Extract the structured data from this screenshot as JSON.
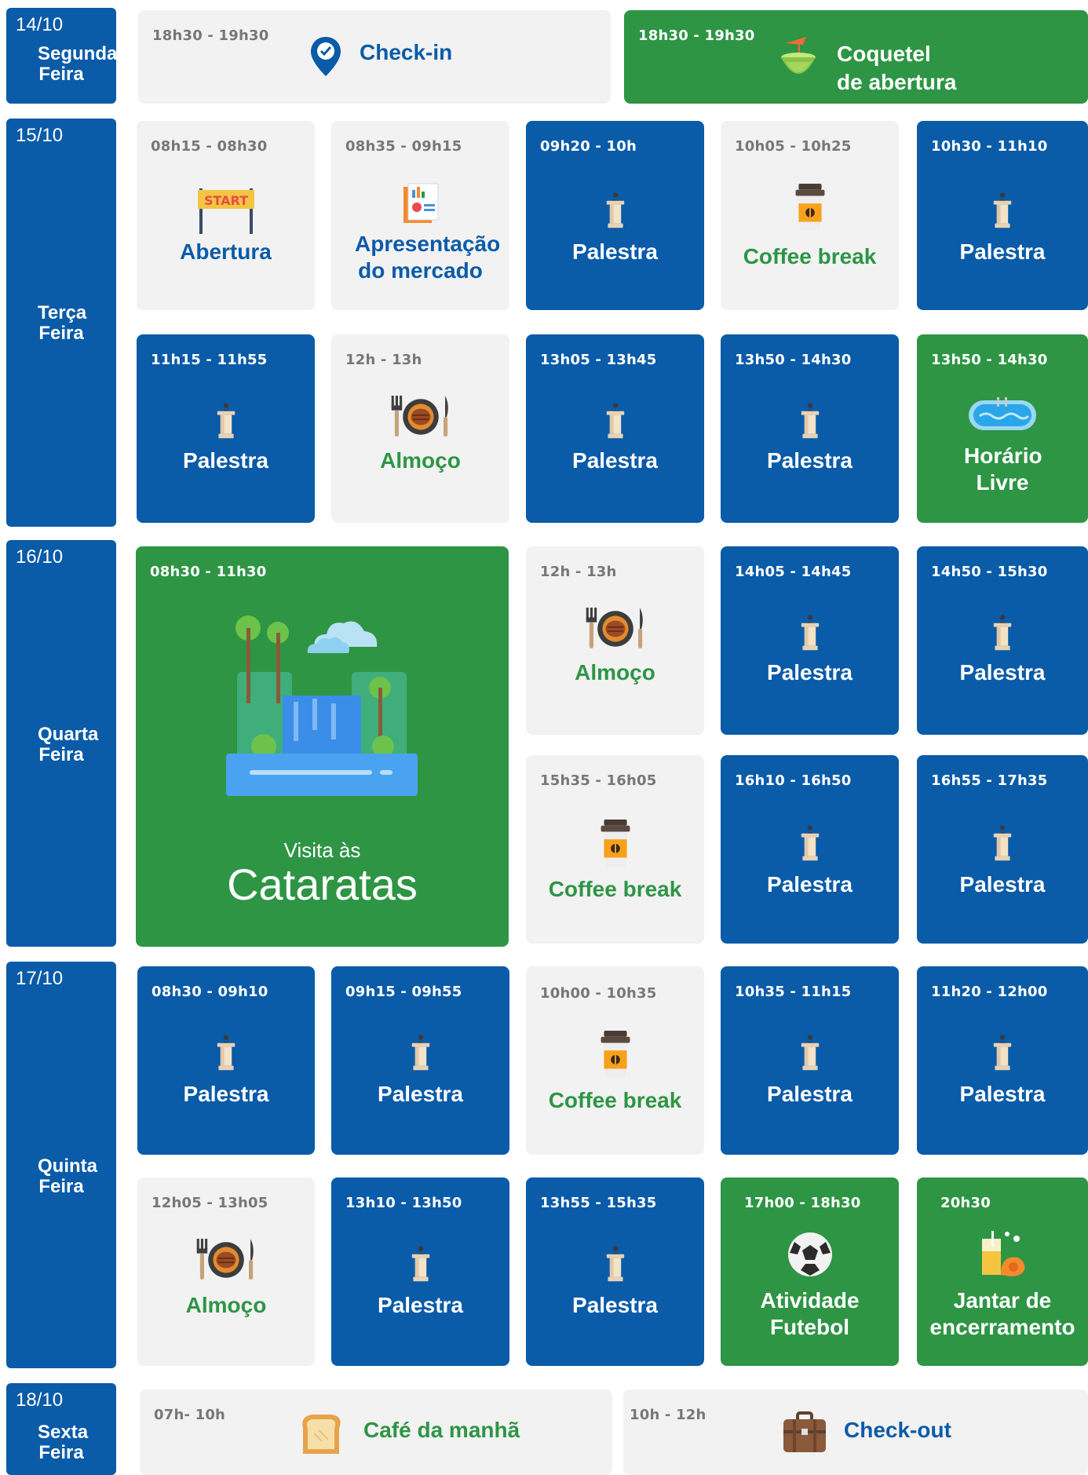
{
  "days": [
    {
      "date": "14/10",
      "name": "Segunda Feira"
    },
    {
      "date": "15/10",
      "name": "Terça Feira"
    },
    {
      "date": "16/10",
      "name": "Quarta Feira"
    },
    {
      "date": "17/10",
      "name": "Quinta Feira"
    },
    {
      "date": "18/10",
      "name": "Sexta Feira"
    }
  ],
  "events": {
    "checkin": {
      "time": "18h30 - 19h30",
      "title": "Check-in",
      "icon": "location-check-icon"
    },
    "coquetel": {
      "time": "18h30 - 19h30",
      "title": "Coquetel de abertura",
      "icon": "coconut-drink-icon"
    },
    "abertura": {
      "time": "08h15 - 08h30",
      "title": "Abertura",
      "icon": "start-banner-icon"
    },
    "mercado": {
      "time": "08h35 - 09h15",
      "title": "Apresentação do mercado",
      "icon": "report-chart-icon"
    },
    "d15_palestra1": {
      "time": "09h20 - 10h",
      "title": "Palestra",
      "icon": "podium-icon"
    },
    "d15_coffee": {
      "time": "10h05 - 10h25",
      "title": "Coffee break",
      "icon": "coffee-cup-icon"
    },
    "d15_palestra2": {
      "time": "10h30 - 11h10",
      "title": "Palestra",
      "icon": "podium-icon"
    },
    "d15_palestra3": {
      "time": "11h15 - 11h55",
      "title": "Palestra",
      "icon": "podium-icon"
    },
    "d15_almoco": {
      "time": "12h - 13h",
      "title": "Almoço",
      "icon": "plate-cutlery-icon"
    },
    "d15_palestra4": {
      "time": "13h05 - 13h45",
      "title": "Palestra",
      "icon": "podium-icon"
    },
    "d15_palestra5": {
      "time": "13h50 - 14h30",
      "title": "Palestra",
      "icon": "podium-icon"
    },
    "d15_livre": {
      "time": "13h50 - 14h30",
      "title": "Horário Livre",
      "icon": "pool-icon"
    },
    "cataratas": {
      "time": "08h30 - 11h30",
      "subtitle": "Visita às",
      "title": "Cataratas",
      "icon": "waterfall-icon"
    },
    "d16_almoco": {
      "time": "12h - 13h",
      "title": "Almoço",
      "icon": "plate-cutlery-icon"
    },
    "d16_palestra1": {
      "time": "14h05 - 14h45",
      "title": "Palestra",
      "icon": "podium-icon"
    },
    "d16_palestra2": {
      "time": "14h50 - 15h30",
      "title": "Palestra",
      "icon": "podium-icon"
    },
    "d16_coffee": {
      "time": "15h35 - 16h05",
      "title": "Coffee break",
      "icon": "coffee-cup-icon"
    },
    "d16_palestra3": {
      "time": "16h10 - 16h50",
      "title": "Palestra",
      "icon": "podium-icon"
    },
    "d16_palestra4": {
      "time": "16h55 - 17h35",
      "title": "Palestra",
      "icon": "podium-icon"
    },
    "d17_palestra1": {
      "time": "08h30 - 09h10",
      "title": "Palestra",
      "icon": "podium-icon"
    },
    "d17_palestra2": {
      "time": "09h15 - 09h55",
      "title": "Palestra",
      "icon": "podium-icon"
    },
    "d17_coffee": {
      "time": "10h00 - 10h35",
      "title": "Coffee break",
      "icon": "coffee-cup-icon"
    },
    "d17_palestra3": {
      "time": "10h35 - 11h15",
      "title": "Palestra",
      "icon": "podium-icon"
    },
    "d17_palestra4": {
      "time": "11h20 - 12h00",
      "title": "Palestra",
      "icon": "podium-icon"
    },
    "d17_almoco": {
      "time": "12h05 - 13h05",
      "title": "Almoço",
      "icon": "plate-cutlery-icon"
    },
    "d17_palestra5": {
      "time": "13h10 - 13h50",
      "title": "Palestra",
      "icon": "podium-icon"
    },
    "d17_palestra6": {
      "time": "13h55 - 15h35",
      "title": "Palestra",
      "icon": "podium-icon"
    },
    "futebol": {
      "time": "17h00 - 18h30",
      "title": "Atividade Futebol",
      "icon": "soccer-ball-icon"
    },
    "jantar": {
      "time": "20h30",
      "title": "Jantar de encerramento",
      "icon": "dinner-drink-icon"
    },
    "cafe": {
      "time": "07h- 10h",
      "title": "Café da manhã",
      "icon": "toast-icon"
    },
    "checkout": {
      "time": "10h - 12h",
      "title": "Check-out",
      "icon": "suitcase-icon"
    }
  },
  "colors": {
    "blue": "#0a5ba8",
    "green": "#2e9545",
    "grey": "#f2f2f2"
  }
}
